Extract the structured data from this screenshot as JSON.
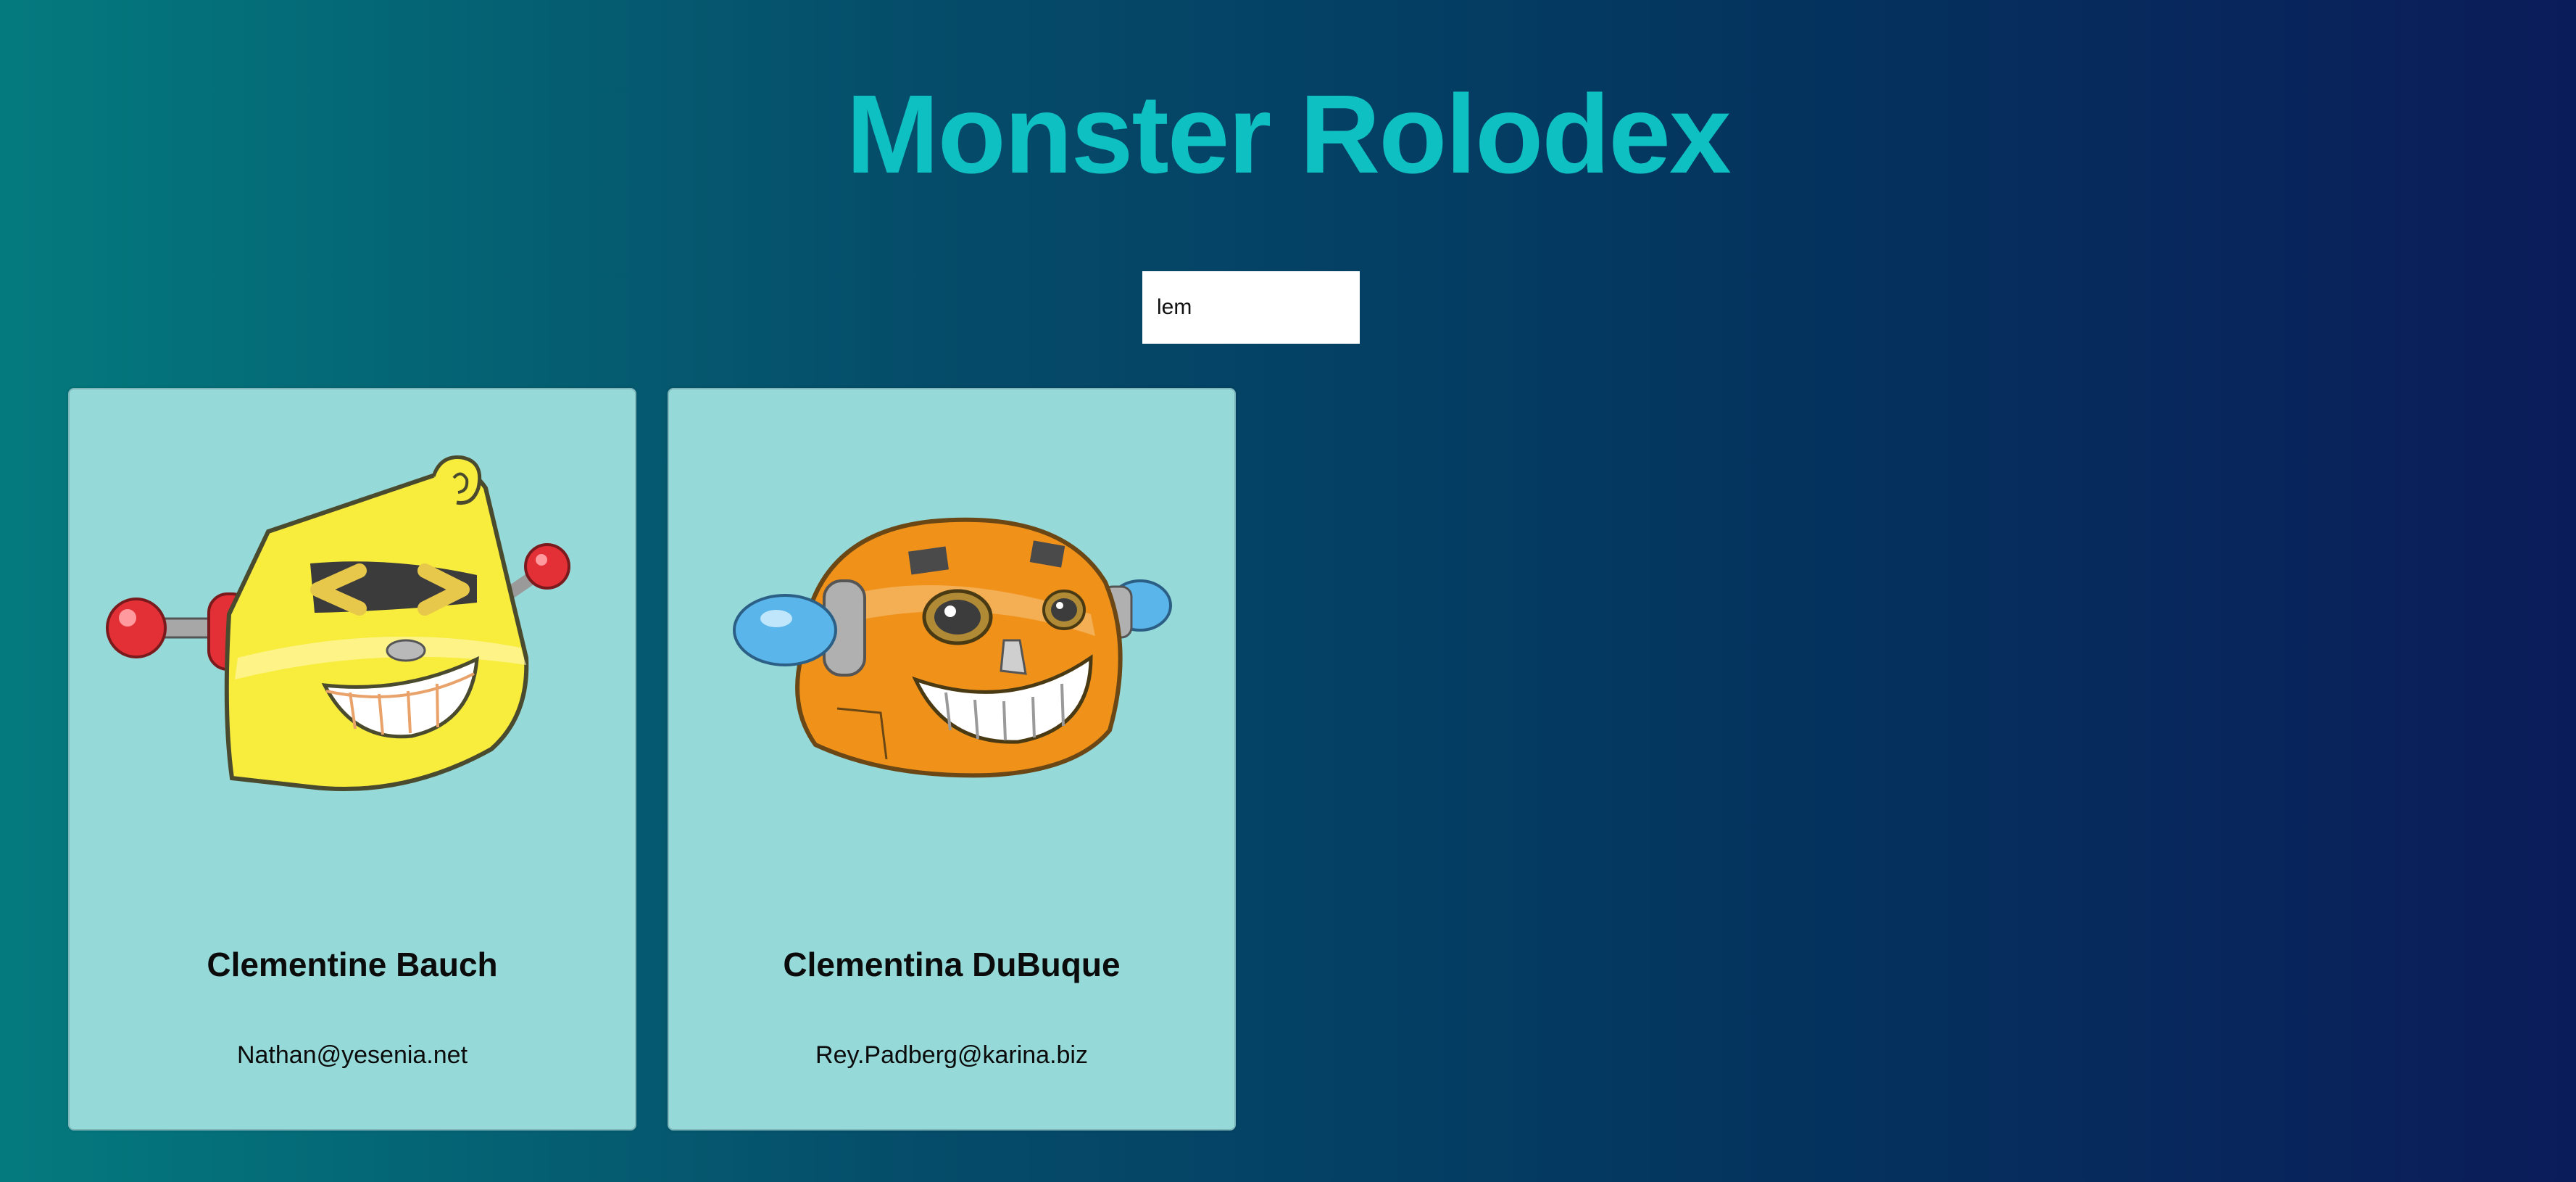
{
  "header": {
    "title": "Monster Rolodex"
  },
  "search": {
    "value": "lem"
  },
  "monsters": [
    {
      "name": "Clementine Bauch",
      "email": "Nathan@yesenia.net",
      "avatar_icon": "yellow-robot-icon"
    },
    {
      "name": "Clementina DuBuque",
      "email": "Rey.Padberg@karina.biz",
      "avatar_icon": "orange-robot-icon"
    }
  ],
  "colors": {
    "title": "#0fc0c2",
    "card_background": "#95d9d9",
    "background_left": "#047a7e",
    "background_right": "#0b1c5a"
  }
}
